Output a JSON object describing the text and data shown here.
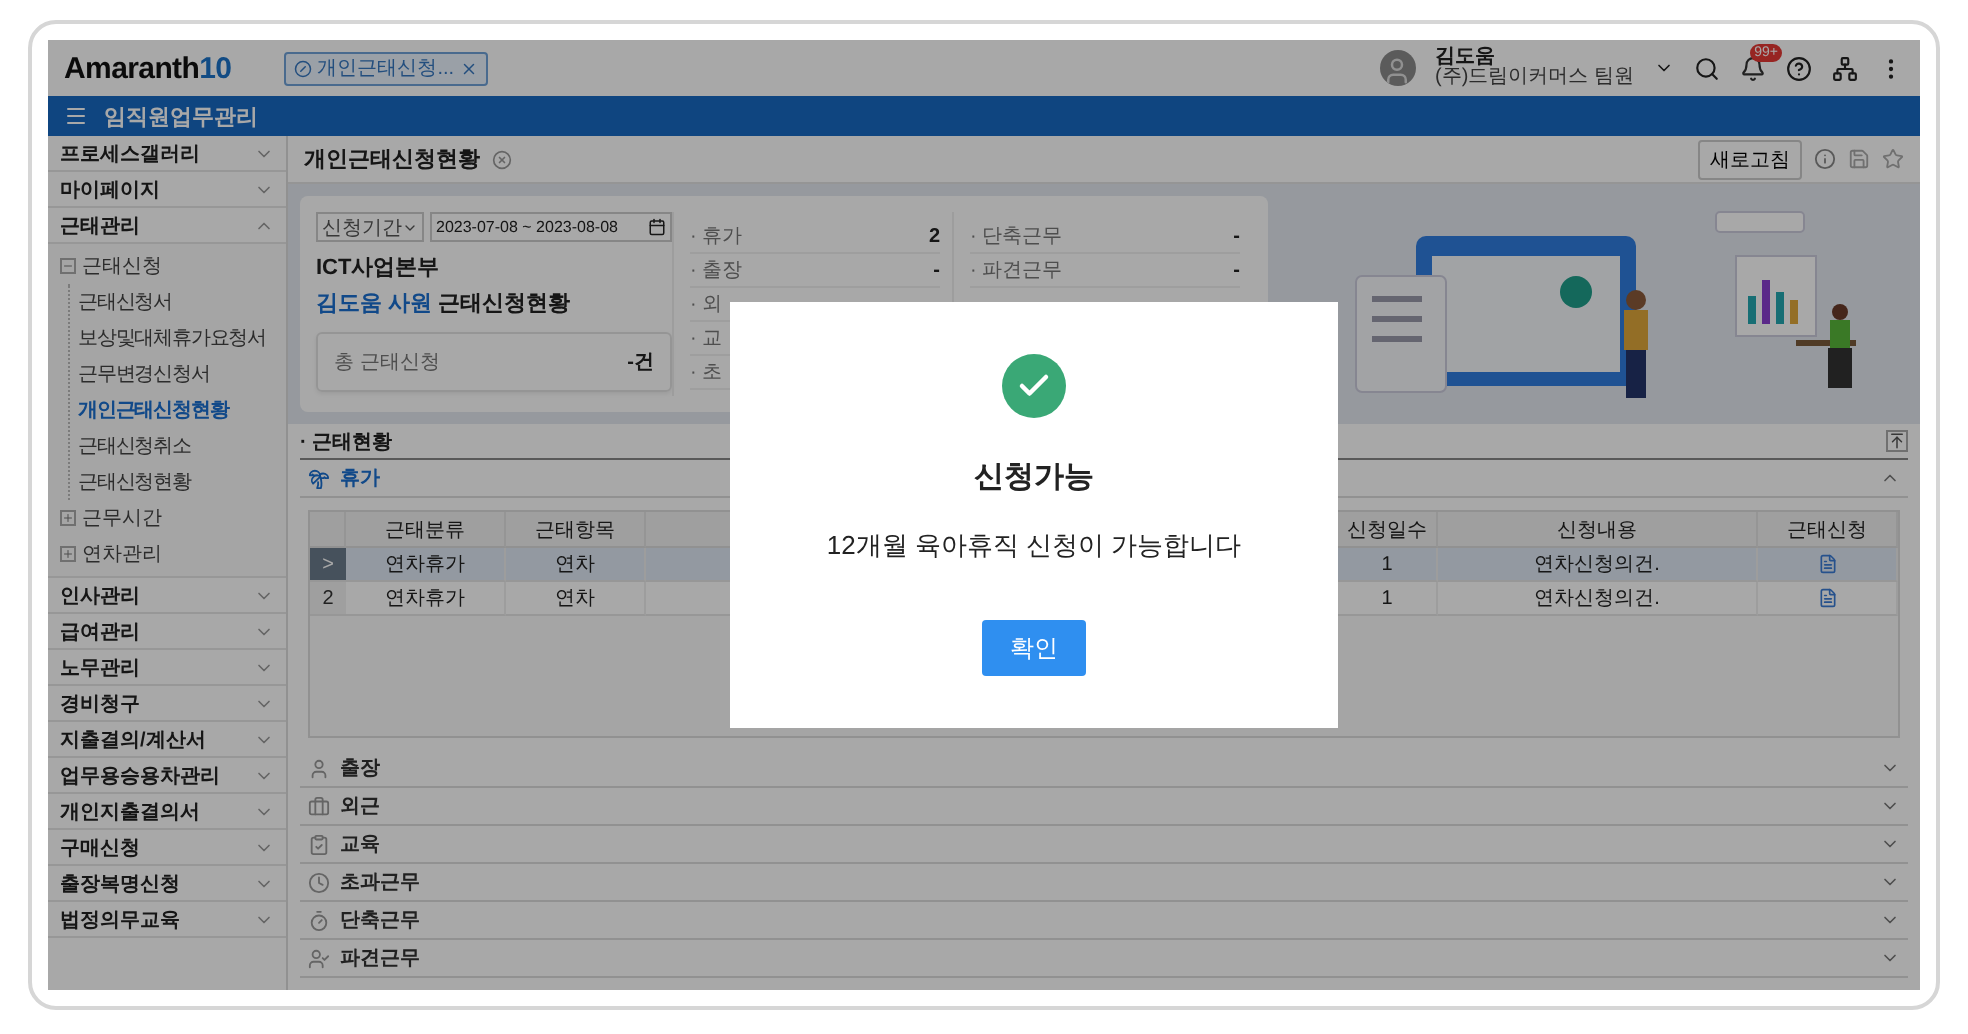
{
  "header": {
    "logo": {
      "name": "Amaranth",
      "version": "10"
    },
    "tabs": [
      {
        "label": "개인근태신청...",
        "selected": true
      }
    ],
    "user": {
      "name": "김도움",
      "org": "(주)드림이커머스 팀원"
    },
    "notification_badge": "99+"
  },
  "menu_bar": {
    "title": "임직원업무관리"
  },
  "sidebar": {
    "items": [
      {
        "label": "프로세스갤러리",
        "expanded": false
      },
      {
        "label": "마이페이지",
        "expanded": false
      },
      {
        "label": "근태관리",
        "expanded": true,
        "children": [
          {
            "label": "근태신청",
            "expanded": true,
            "children": [
              {
                "label": "근태신청서",
                "selected": false
              },
              {
                "label": "보상및대체휴가요청서",
                "selected": false
              },
              {
                "label": "근무변경신청서",
                "selected": false
              },
              {
                "label": "개인근태신청현황",
                "selected": true
              },
              {
                "label": "근태신청취소",
                "selected": false
              },
              {
                "label": "근태신청현황",
                "selected": false
              }
            ]
          },
          {
            "label": "근무시간",
            "expanded": false
          },
          {
            "label": "연차관리",
            "expanded": false
          }
        ]
      },
      {
        "label": "인사관리",
        "expanded": false
      },
      {
        "label": "급여관리",
        "expanded": false
      },
      {
        "label": "노무관리",
        "expanded": false
      },
      {
        "label": "경비청구",
        "expanded": false
      },
      {
        "label": "지출결의/계산서",
        "expanded": false
      },
      {
        "label": "업무용승용차관리",
        "expanded": false
      },
      {
        "label": "개인지출결의서",
        "expanded": false
      },
      {
        "label": "구매신청",
        "expanded": false
      },
      {
        "label": "출장복명신청",
        "expanded": false
      },
      {
        "label": "법정의무교육",
        "expanded": false
      }
    ]
  },
  "page": {
    "title": "개인근태신청현황",
    "refresh_button": "새로고침"
  },
  "summary": {
    "period_select": "신청기간",
    "date_range": "2023-07-08 ~ 2023-08-08",
    "department": "ICT사업본부",
    "employee": "김도움 사원",
    "heading": "근태신청현황",
    "total": {
      "label": "총 근태신청",
      "value": "-건"
    },
    "counts_left": [
      {
        "label": "· 휴가",
        "value": "2"
      },
      {
        "label": "· 출장",
        "value": "-"
      },
      {
        "label": "· 외"
      },
      {
        "label": "· 교"
      },
      {
        "label": "· 초"
      }
    ],
    "counts_right": [
      {
        "label": "· 단축근무",
        "value": "-"
      },
      {
        "label": "· 파견근무",
        "value": "-"
      }
    ]
  },
  "section": {
    "title": "· 근태현황",
    "groups": [
      {
        "kind": "vacation",
        "label": "휴가",
        "expanded": true,
        "table": {
          "columns": [
            "근태분류",
            "근태항목",
            "신청일수",
            "신청내용",
            "근태신청"
          ],
          "rows": [
            {
              "marker": ">",
              "selected": true,
              "cells": [
                "연차휴가",
                "연차",
                "1",
                "연차신청의건."
              ]
            },
            {
              "marker": "2",
              "selected": false,
              "cells": [
                "연차휴가",
                "연차",
                "1",
                "연차신청의건."
              ]
            }
          ]
        }
      },
      {
        "kind": "trip",
        "label": "출장",
        "expanded": false
      },
      {
        "kind": "outside",
        "label": "외근",
        "expanded": false
      },
      {
        "kind": "education",
        "label": "교육",
        "expanded": false
      },
      {
        "kind": "overtime",
        "label": "초과근무",
        "expanded": false
      },
      {
        "kind": "short",
        "label": "단축근무",
        "expanded": false
      },
      {
        "kind": "dispatch",
        "label": "파견근무",
        "expanded": false
      }
    ]
  },
  "dialog": {
    "title": "신청가능",
    "message": "12개월 육아휴직 신청이 가능합니다",
    "confirm_button": "확인"
  }
}
